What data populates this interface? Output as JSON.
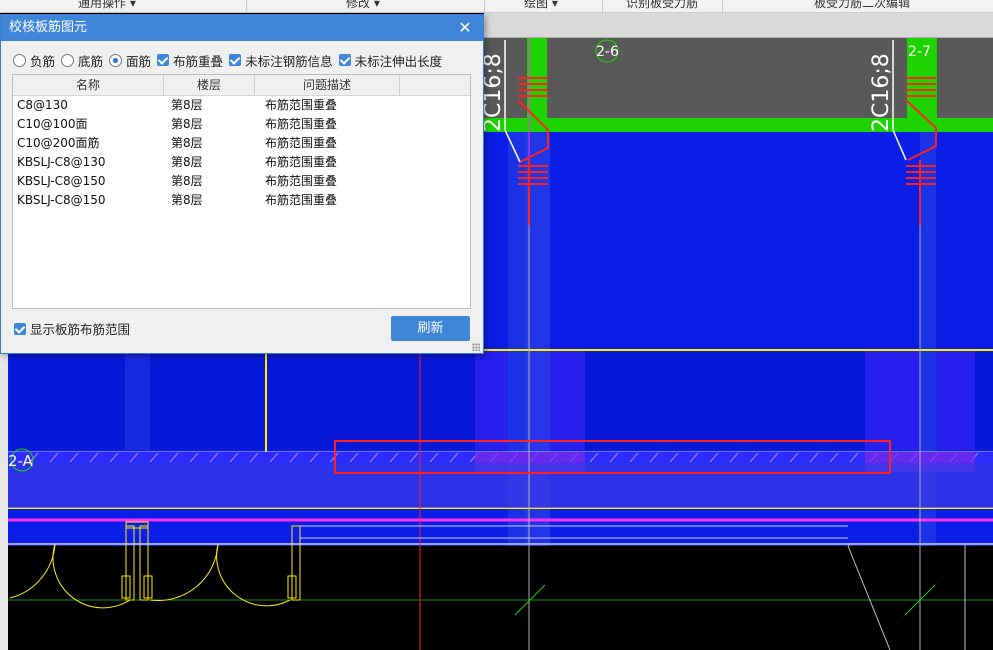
{
  "ribbon": {
    "groups": [
      "通用操作 ▾",
      "修改 ▾",
      "绘图 ▾",
      "识别板受力筋",
      "板受力筋二次编辑"
    ]
  },
  "canvas": {
    "axis_labels": [
      "2-6",
      "2-7",
      "2-A"
    ],
    "rebar_labels": [
      "2C16;8",
      "2C16;8"
    ],
    "colors": {
      "slab": "#0a1ee8",
      "wall": "#595959",
      "beam": "#1ed400",
      "highlight": "#ff2020",
      "hatch": "#8a2be2"
    }
  },
  "dialog": {
    "title": "校核板筋图元",
    "close_icon": "close-icon",
    "options": {
      "radio_neg": "负筋",
      "radio_bottom": "底筋",
      "radio_top": "面筋",
      "selected_radio": "面筋",
      "chk_overlap": "布筋重叠",
      "chk_unlabeled": "未标注钢筋信息",
      "chk_extension": "未标注伸出长度"
    },
    "table": {
      "headers": [
        "名称",
        "楼层",
        "问题描述"
      ],
      "rows": [
        {
          "name": "C8@130",
          "floor": "第8层",
          "issue": "布筋范围重叠"
        },
        {
          "name": "C10@100面",
          "floor": "第8层",
          "issue": "布筋范围重叠"
        },
        {
          "name": "C10@200面筋",
          "floor": "第8层",
          "issue": "布筋范围重叠"
        },
        {
          "name": "KBSLJ-C8@130",
          "floor": "第8层",
          "issue": "布筋范围重叠"
        },
        {
          "name": "KBSLJ-C8@150",
          "floor": "第8层",
          "issue": "布筋范围重叠"
        },
        {
          "name": "KBSLJ-C8@150",
          "floor": "第8层",
          "issue": "布筋范围重叠"
        }
      ]
    },
    "show_range_label": "显示板筋布筋范围",
    "refresh_label": "刷新"
  }
}
